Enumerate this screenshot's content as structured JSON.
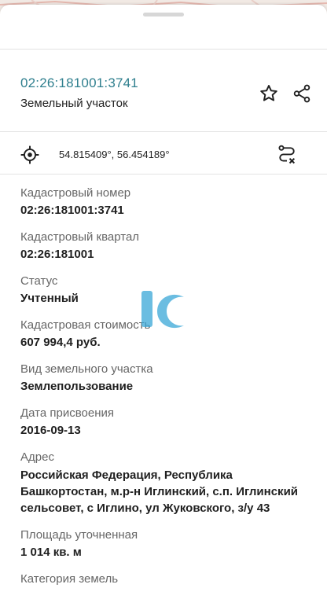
{
  "header": {
    "cadastral_number": "02:26:181001:3741",
    "object_type": "Земельный участок"
  },
  "coords_bar": {
    "coordinates": "54.815409°, 56.454189°"
  },
  "fields": [
    {
      "label": "Кадастровый номер",
      "value": "02:26:181001:3741"
    },
    {
      "label": "Кадастровый квартал",
      "value": "02:26:181001"
    },
    {
      "label": "Статус",
      "value": "Учтенный"
    },
    {
      "label": "Кадастровая стоимость",
      "value": "607 994,4 руб."
    },
    {
      "label": "Вид земельного участка",
      "value": "Землепользование"
    },
    {
      "label": "Дата присвоения",
      "value": "2016-09-13"
    },
    {
      "label": "Адрес",
      "value": "Российская Федерация, Республика Башкортостан, м.р-н Иглинский, с.п. Иглинский сельсовет, с Иглино, ул Жуковского, з/у 43"
    },
    {
      "label": "Площадь уточненная",
      "value": "1 014 кв. м"
    },
    {
      "label": "Категория земель",
      "value": ""
    }
  ],
  "icons": {
    "favorite": "star-outline-icon",
    "share": "share-icon",
    "locate": "crosshair-icon",
    "route": "route-clear-icon"
  },
  "colors": {
    "accent": "#2f7f8e",
    "watermark": "#3aa8d8"
  }
}
